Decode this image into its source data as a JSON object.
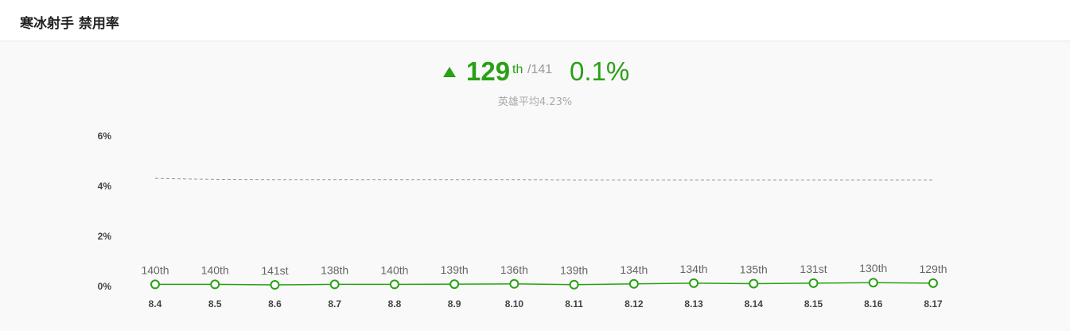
{
  "header": {
    "title": "寒冰射手 禁用率"
  },
  "summary": {
    "rank": "129",
    "rank_suffix": "th",
    "rank_total": "/141",
    "rate": "0.1%",
    "average_label": "英雄平均4.23%"
  },
  "colors": {
    "accent": "#2aa015",
    "average_line": "#999999",
    "text": "#444444"
  },
  "chart_data": {
    "type": "line",
    "categories": [
      "8.4",
      "8.5",
      "8.6",
      "8.7",
      "8.8",
      "8.9",
      "8.10",
      "8.11",
      "8.12",
      "8.13",
      "8.14",
      "8.15",
      "8.16",
      "8.17"
    ],
    "series": [
      {
        "values": [
          0.05,
          0.05,
          0.03,
          0.05,
          0.05,
          0.06,
          0.07,
          0.04,
          0.07,
          0.1,
          0.08,
          0.1,
          0.12,
          0.1
        ],
        "point_labels": [
          "140th",
          "140th",
          "141st",
          "138th",
          "140th",
          "139th",
          "136th",
          "139th",
          "134th",
          "134th",
          "135th",
          "131st",
          "130th",
          "129th"
        ]
      }
    ],
    "average": [
      4.28,
      4.24,
      4.23,
      4.23,
      4.23,
      4.23,
      4.23,
      4.22,
      4.22,
      4.22,
      4.22,
      4.22,
      4.22,
      4.22
    ],
    "yticks": [
      "0%",
      "2%",
      "4%",
      "6%"
    ],
    "ylim": [
      0,
      6
    ],
    "grid": false,
    "legend": "none"
  }
}
